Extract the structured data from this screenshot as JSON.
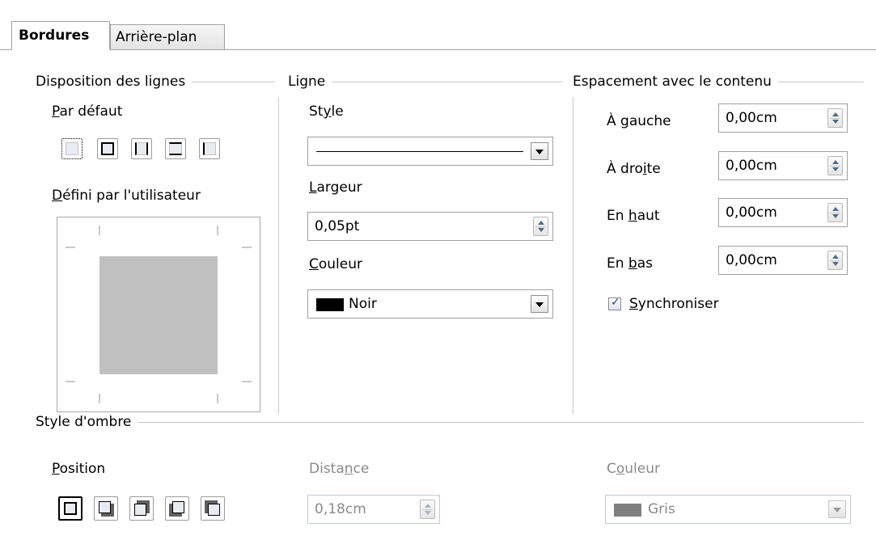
{
  "tabs": [
    {
      "label": "Bordures",
      "active": true
    },
    {
      "label": "Arrière-plan",
      "active": false
    }
  ],
  "line_arrangement": {
    "title": "Disposition des lignes",
    "default_label": "Par défaut",
    "default_presets": [
      "none",
      "all",
      "left-right",
      "top-bottom",
      "left"
    ],
    "user_defined_label": "Défini par l'utilisateur"
  },
  "line": {
    "title": "Ligne",
    "style_label": "Style",
    "style_value": "solid",
    "width_label": "Largeur",
    "width_value": "0,05pt",
    "color_label": "Couleur",
    "color_value": "Noir",
    "color_swatch": "#000000"
  },
  "spacing": {
    "title": "Espacement avec le contenu",
    "left_label": "À gauche",
    "left_value": "0,00cm",
    "right_label": "À droite",
    "right_value": "0,00cm",
    "top_label": "En haut",
    "top_value": "0,00cm",
    "bottom_label": "En bas",
    "bottom_value": "0,00cm",
    "sync_label": "Synchroniser",
    "sync_checked": true
  },
  "shadow": {
    "title": "Style d'ombre",
    "position_label": "Position",
    "positions": [
      "none",
      "bottom-right",
      "top-right",
      "bottom-left",
      "top-left"
    ],
    "distance_label": "Distance",
    "distance_value": "0,18cm",
    "color_label": "Couleur",
    "color_value": "Gris",
    "color_swatch": "#808080"
  }
}
